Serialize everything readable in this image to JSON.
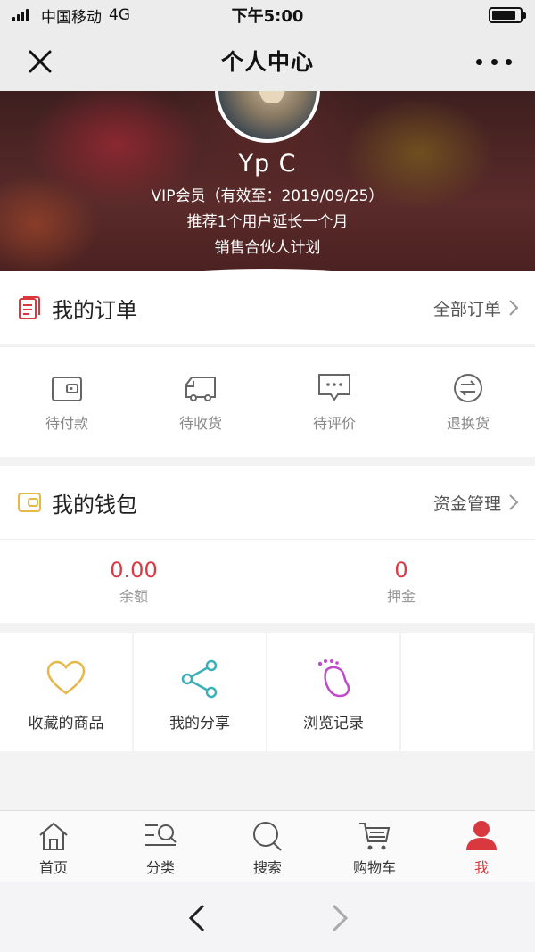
{
  "status_bar": {
    "carrier": "中国移动",
    "network": "4G",
    "time": "下午5:00",
    "battery_level": 0.85
  },
  "nav": {
    "title": "个人中心"
  },
  "profile": {
    "username": "Yp C",
    "vip": "VIP会员（有效至：2019/09/25）",
    "recommend": "推荐1个用户延长一个月",
    "partner": "销售合伙人计划"
  },
  "orders": {
    "title": "我的订单",
    "all_link": "全部订单",
    "items": [
      {
        "label": "待付款",
        "icon": "wallet-icon"
      },
      {
        "label": "待收货",
        "icon": "truck-icon"
      },
      {
        "label": "待评价",
        "icon": "comment-icon"
      },
      {
        "label": "退换货",
        "icon": "exchange-icon"
      }
    ]
  },
  "wallet": {
    "title": "我的钱包",
    "manage_link": "资金管理",
    "items": [
      {
        "value": "0.00",
        "label": "余额"
      },
      {
        "value": "0",
        "label": "押金"
      }
    ]
  },
  "tools": [
    {
      "label": "收藏的商品",
      "icon": "heart-icon",
      "color": "#e6b84a"
    },
    {
      "label": "我的分享",
      "icon": "share-icon",
      "color": "#3bb0b8"
    },
    {
      "label": "浏览记录",
      "icon": "footprint-icon",
      "color": "#c04bc9"
    }
  ],
  "tabs": [
    {
      "label": "首页",
      "icon": "home-icon"
    },
    {
      "label": "分类",
      "icon": "category-icon"
    },
    {
      "label": "搜索",
      "icon": "search-icon"
    },
    {
      "label": "购物车",
      "icon": "cart-icon"
    },
    {
      "label": "我",
      "icon": "user-icon",
      "active": true
    }
  ],
  "colors": {
    "accent": "#d9383f",
    "price": "#d93a44"
  }
}
